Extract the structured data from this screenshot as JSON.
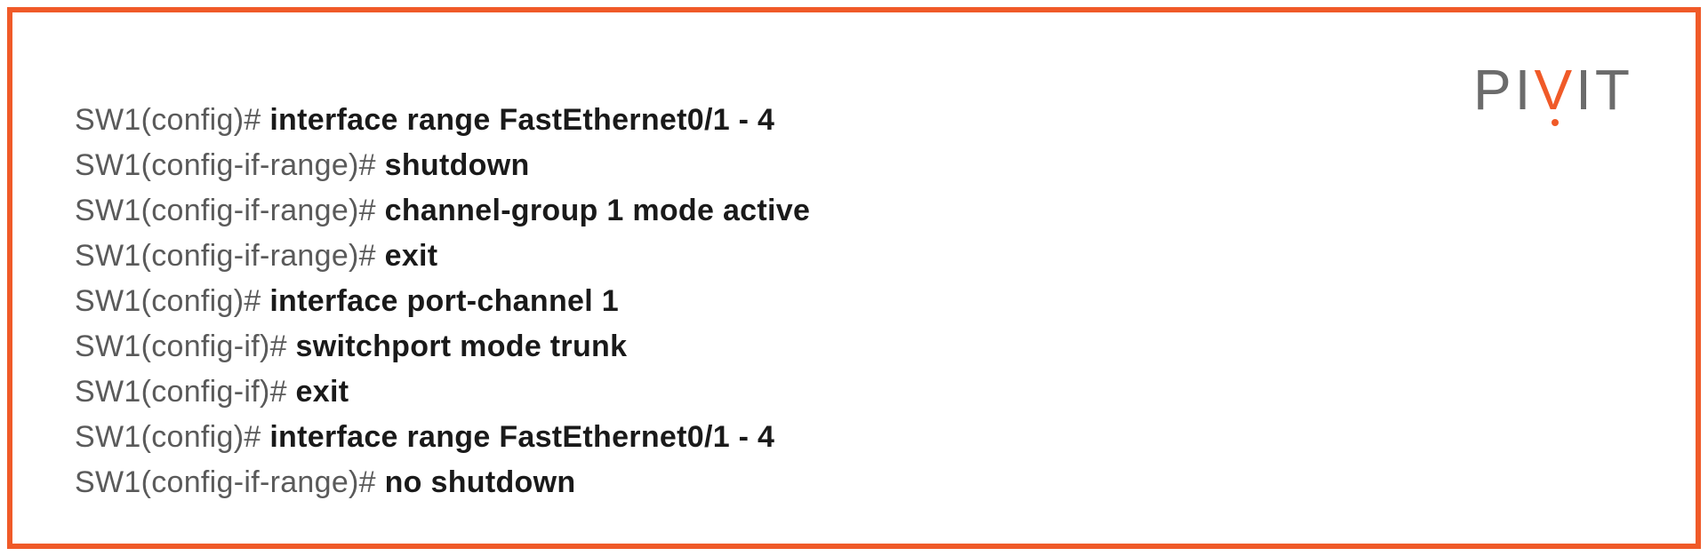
{
  "logo": {
    "p1": "P",
    "i1": "I",
    "v": "V",
    "i2": "I",
    "t": "T"
  },
  "cli": {
    "lines": [
      {
        "prompt": "SW1(config)# ",
        "command": "interface range FastEthernet0/1 - 4"
      },
      {
        "prompt": "SW1(config-if-range)# ",
        "command": "shutdown"
      },
      {
        "prompt": "SW1(config-if-range)# ",
        "command": "channel-group 1 mode active"
      },
      {
        "prompt": "SW1(config-if-range)# ",
        "command": "exit"
      },
      {
        "prompt": "SW1(config)# ",
        "command": "interface port-channel 1"
      },
      {
        "prompt": "SW1(config-if)# ",
        "command": "switchport mode trunk"
      },
      {
        "prompt": "SW1(config-if)# ",
        "command": "exit"
      },
      {
        "prompt": "SW1(config)# ",
        "command": "interface range FastEthernet0/1 - 4"
      },
      {
        "prompt": "SW1(config-if-range)# ",
        "command": "no shutdown"
      }
    ]
  }
}
